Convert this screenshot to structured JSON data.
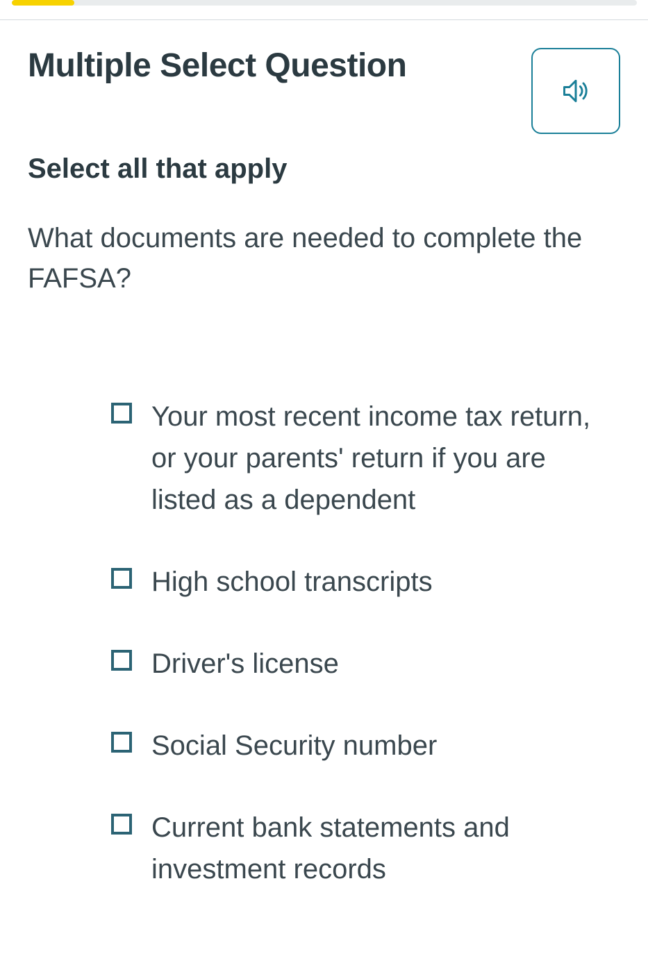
{
  "progress": {
    "percent": 10
  },
  "title": "Multiple Select Question",
  "audio_icon": "speaker-icon",
  "subtitle": "Select all that apply",
  "question": "What documents are needed to complete the FAFSA?",
  "options": [
    {
      "label": "Your most recent income tax return, or your parents' return if you are list­ed as a dependent"
    },
    {
      "label": "High school transcripts"
    },
    {
      "label": "Driver's license"
    },
    {
      "label": "Social Security number"
    },
    {
      "label": "Current bank statements and invest­ment records"
    }
  ]
}
